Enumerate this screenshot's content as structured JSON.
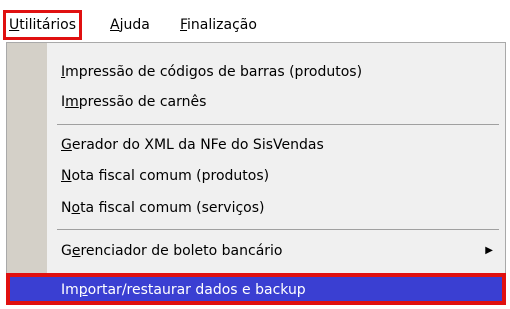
{
  "menubar": {
    "items": [
      {
        "label_pre": "",
        "label_u": "U",
        "label_post": "tilitários"
      },
      {
        "label_pre": "",
        "label_u": "A",
        "label_post": "juda"
      },
      {
        "label_pre": "",
        "label_u": "F",
        "label_post": "inalização"
      }
    ]
  },
  "menu": {
    "items": [
      {
        "pre": "",
        "u": "I",
        "post": "mpressão de códigos de barras (produtos)"
      },
      {
        "pre": "I",
        "u": "m",
        "post": "pressão de carnês"
      },
      {
        "pre": "",
        "u": "G",
        "post": "erador do XML da NFe do SisVendas"
      },
      {
        "pre": "",
        "u": "N",
        "post": "ota fiscal comum (produtos)"
      },
      {
        "pre": "N",
        "u": "o",
        "post": "ta fiscal comum (serviços)"
      },
      {
        "pre": "G",
        "u": "e",
        "post": "renciador de boleto bancário"
      },
      {
        "pre": "Im",
        "u": "p",
        "post": "ortar/restaurar dados e backup"
      }
    ],
    "submenu_arrow": "▶"
  },
  "colors": {
    "highlight_outline": "#e01010",
    "selection_background": "#3a3fd2"
  }
}
